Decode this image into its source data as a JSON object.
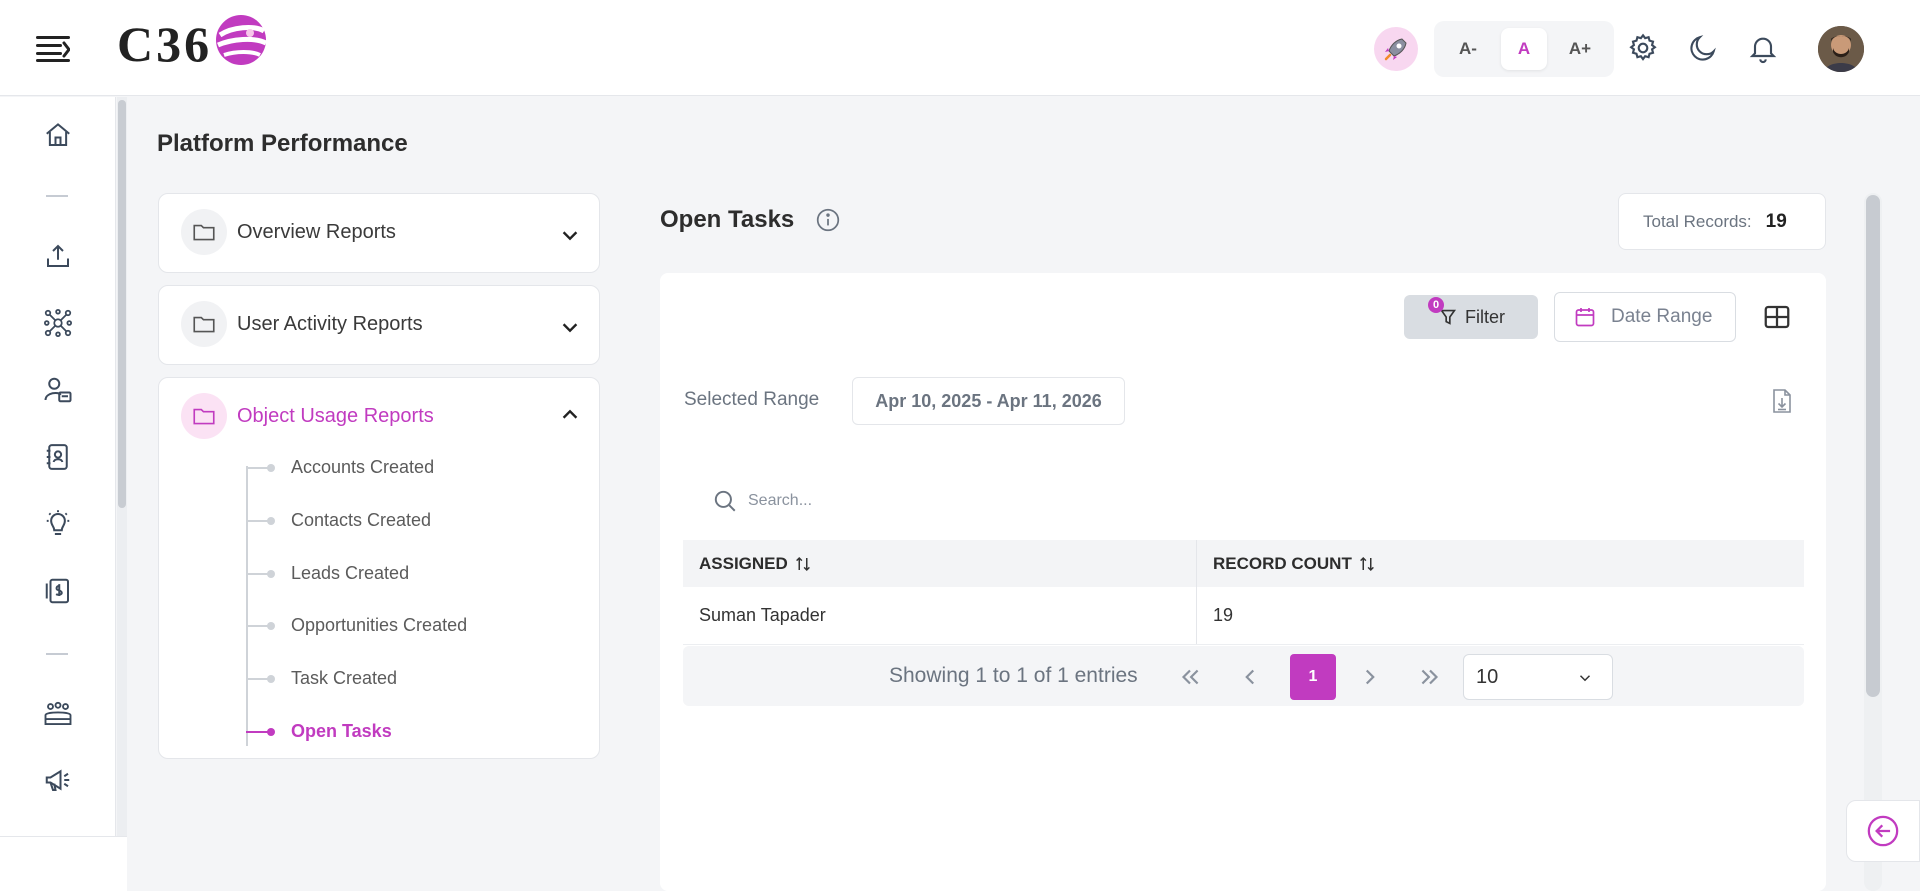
{
  "header": {
    "logo_text": "C36",
    "font_sizes": [
      "A-",
      "A",
      "A+"
    ],
    "active_font": "A"
  },
  "colors": {
    "accent": "#c13bc0",
    "accent_soft": "#fbe2f4",
    "muted": "#6b7480"
  },
  "page": {
    "title": "Platform Performance"
  },
  "reports": {
    "overview": "Overview Reports",
    "user_activity": "User Activity Reports",
    "object_usage": "Object Usage Reports",
    "items": [
      "Accounts Created",
      "Contacts Created",
      "Leads Created",
      "Opportunities Created",
      "Task Created",
      "Open Tasks"
    ],
    "active_item": "Open Tasks"
  },
  "main": {
    "title": "Open Tasks",
    "total_label": "Total Records:",
    "total_value": "19",
    "filter_label": "Filter",
    "filter_count": "0",
    "date_range_label": "Date Range",
    "selected_range_label": "Selected Range",
    "selected_range_value": "Apr 10, 2025 - Apr 11, 2026",
    "search_placeholder": "Search..."
  },
  "table": {
    "columns": [
      "ASSIGNED",
      "RECORD COUNT"
    ],
    "rows": [
      {
        "assigned": "Suman Tapader",
        "count": "19"
      }
    ]
  },
  "pagination": {
    "summary": "Showing 1 to 1 of 1 entries",
    "current_page": "1",
    "page_size": "10"
  }
}
